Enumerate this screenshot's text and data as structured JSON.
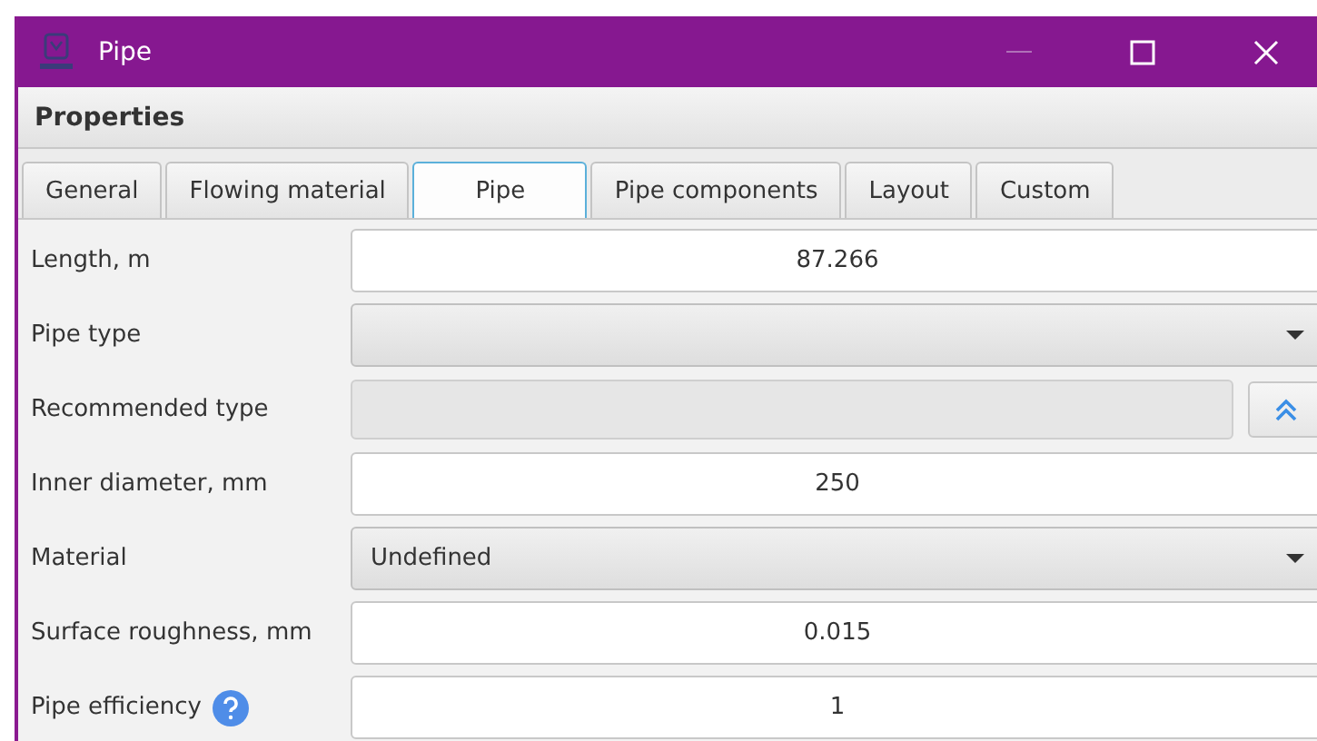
{
  "window": {
    "title": "Pipe"
  },
  "panel": {
    "title": "Properties"
  },
  "tabs": [
    {
      "label": "General",
      "selected": false
    },
    {
      "label": "Flowing material",
      "selected": false
    },
    {
      "label": "Pipe",
      "selected": true
    },
    {
      "label": "Pipe components",
      "selected": false
    },
    {
      "label": "Layout",
      "selected": false
    },
    {
      "label": "Custom",
      "selected": false
    }
  ],
  "fields": [
    {
      "label": "Length, m",
      "kind": "text",
      "value": "87.266"
    },
    {
      "label": "Pipe type",
      "kind": "dropdown"
    },
    {
      "label": "Recommended type",
      "kind": "readonly"
    },
    {
      "label": "Inner diameter, mm",
      "kind": "text",
      "value": "250"
    },
    {
      "label": "Material",
      "kind": "dropdown",
      "value": "Undefined"
    },
    {
      "label": "Surface roughness, mm",
      "kind": "text",
      "value": "0.015"
    },
    {
      "label": "Pipe efficiency",
      "kind": "text",
      "value": "1",
      "help": true
    }
  ]
}
